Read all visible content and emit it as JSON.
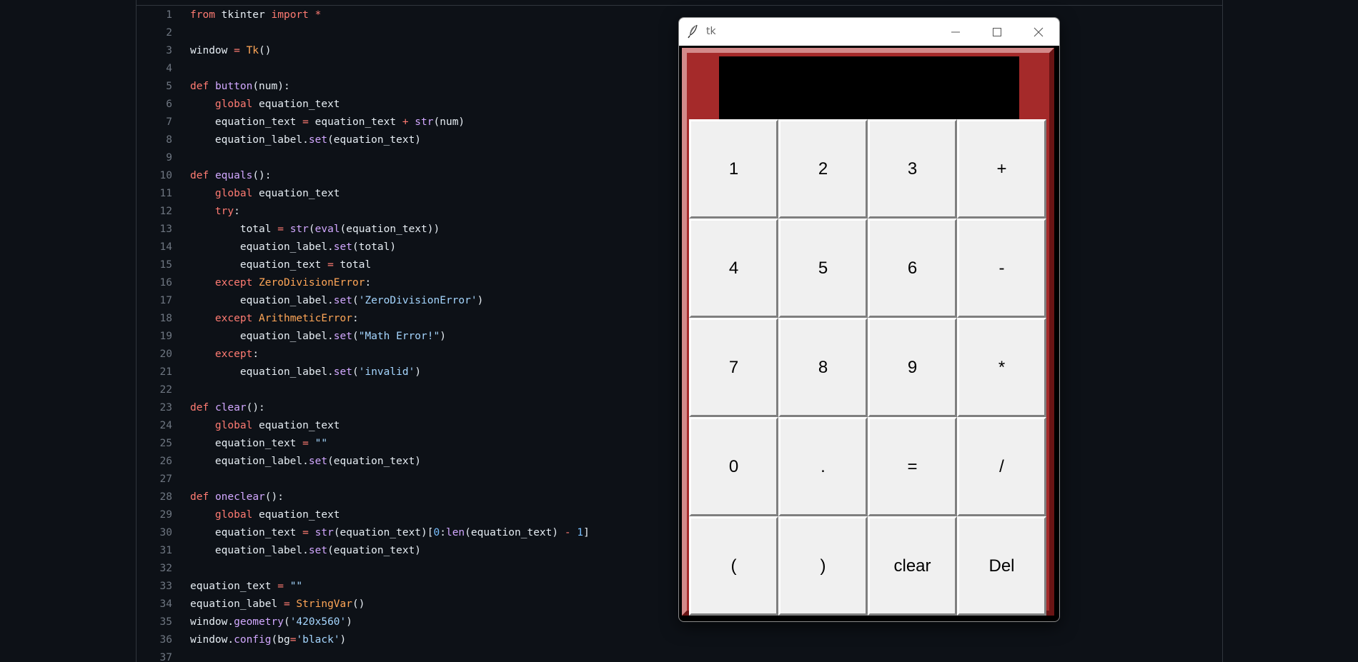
{
  "editor": {
    "lines": [
      {
        "n": "1",
        "tokens": [
          {
            "t": "from",
            "c": "kw"
          },
          {
            "t": " tkinter "
          },
          {
            "t": "import",
            "c": "kw"
          },
          {
            "t": " "
          },
          {
            "t": "*",
            "c": "op"
          }
        ]
      },
      {
        "n": "2",
        "tokens": []
      },
      {
        "n": "3",
        "tokens": [
          {
            "t": "window "
          },
          {
            "t": "=",
            "c": "op"
          },
          {
            "t": " "
          },
          {
            "t": "Tk",
            "c": "cls"
          },
          {
            "t": "()"
          }
        ]
      },
      {
        "n": "4",
        "tokens": []
      },
      {
        "n": "5",
        "tokens": [
          {
            "t": "def",
            "c": "kw"
          },
          {
            "t": " "
          },
          {
            "t": "button",
            "c": "fn"
          },
          {
            "t": "(num):"
          }
        ]
      },
      {
        "n": "6",
        "tokens": [
          {
            "t": "    "
          },
          {
            "t": "global",
            "c": "kw"
          },
          {
            "t": " equation_text"
          }
        ]
      },
      {
        "n": "7",
        "tokens": [
          {
            "t": "    equation_text "
          },
          {
            "t": "=",
            "c": "op"
          },
          {
            "t": " equation_text "
          },
          {
            "t": "+",
            "c": "op"
          },
          {
            "t": " "
          },
          {
            "t": "str",
            "c": "fn"
          },
          {
            "t": "(num)"
          }
        ]
      },
      {
        "n": "8",
        "tokens": [
          {
            "t": "    equation_label."
          },
          {
            "t": "set",
            "c": "fn"
          },
          {
            "t": "(equation_text)"
          }
        ]
      },
      {
        "n": "9",
        "tokens": []
      },
      {
        "n": "10",
        "tokens": [
          {
            "t": "def",
            "c": "kw"
          },
          {
            "t": " "
          },
          {
            "t": "equals",
            "c": "fn"
          },
          {
            "t": "():"
          }
        ]
      },
      {
        "n": "11",
        "tokens": [
          {
            "t": "    "
          },
          {
            "t": "global",
            "c": "kw"
          },
          {
            "t": " equation_text"
          }
        ]
      },
      {
        "n": "12",
        "tokens": [
          {
            "t": "    "
          },
          {
            "t": "try",
            "c": "kw"
          },
          {
            "t": ":"
          }
        ]
      },
      {
        "n": "13",
        "tokens": [
          {
            "t": "        total "
          },
          {
            "t": "=",
            "c": "op"
          },
          {
            "t": " "
          },
          {
            "t": "str",
            "c": "fn"
          },
          {
            "t": "("
          },
          {
            "t": "eval",
            "c": "fn"
          },
          {
            "t": "(equation_text))"
          }
        ]
      },
      {
        "n": "14",
        "tokens": [
          {
            "t": "        equation_label."
          },
          {
            "t": "set",
            "c": "fn"
          },
          {
            "t": "(total)"
          }
        ]
      },
      {
        "n": "15",
        "tokens": [
          {
            "t": "        equation_text "
          },
          {
            "t": "=",
            "c": "op"
          },
          {
            "t": " total"
          }
        ]
      },
      {
        "n": "16",
        "tokens": [
          {
            "t": "    "
          },
          {
            "t": "except",
            "c": "kw"
          },
          {
            "t": " "
          },
          {
            "t": "ZeroDivisionError",
            "c": "cls"
          },
          {
            "t": ":"
          }
        ]
      },
      {
        "n": "17",
        "tokens": [
          {
            "t": "        equation_label."
          },
          {
            "t": "set",
            "c": "fn"
          },
          {
            "t": "("
          },
          {
            "t": "'ZeroDivisionError'",
            "c": "str"
          },
          {
            "t": ")"
          }
        ]
      },
      {
        "n": "18",
        "tokens": [
          {
            "t": "    "
          },
          {
            "t": "except",
            "c": "kw"
          },
          {
            "t": " "
          },
          {
            "t": "ArithmeticError",
            "c": "cls"
          },
          {
            "t": ":"
          }
        ]
      },
      {
        "n": "19",
        "tokens": [
          {
            "t": "        equation_label."
          },
          {
            "t": "set",
            "c": "fn"
          },
          {
            "t": "("
          },
          {
            "t": "\"Math Error!\"",
            "c": "str"
          },
          {
            "t": ")"
          }
        ]
      },
      {
        "n": "20",
        "tokens": [
          {
            "t": "    "
          },
          {
            "t": "except",
            "c": "kw"
          },
          {
            "t": ":"
          }
        ]
      },
      {
        "n": "21",
        "tokens": [
          {
            "t": "        equation_label."
          },
          {
            "t": "set",
            "c": "fn"
          },
          {
            "t": "("
          },
          {
            "t": "'invalid'",
            "c": "str"
          },
          {
            "t": ")"
          }
        ]
      },
      {
        "n": "22",
        "tokens": []
      },
      {
        "n": "23",
        "tokens": [
          {
            "t": "def",
            "c": "kw"
          },
          {
            "t": " "
          },
          {
            "t": "clear",
            "c": "fn"
          },
          {
            "t": "():"
          }
        ]
      },
      {
        "n": "24",
        "tokens": [
          {
            "t": "    "
          },
          {
            "t": "global",
            "c": "kw"
          },
          {
            "t": " equation_text"
          }
        ]
      },
      {
        "n": "25",
        "tokens": [
          {
            "t": "    equation_text "
          },
          {
            "t": "=",
            "c": "op"
          },
          {
            "t": " "
          },
          {
            "t": "\"\"",
            "c": "str"
          }
        ]
      },
      {
        "n": "26",
        "tokens": [
          {
            "t": "    equation_label."
          },
          {
            "t": "set",
            "c": "fn"
          },
          {
            "t": "(equation_text)"
          }
        ]
      },
      {
        "n": "27",
        "tokens": []
      },
      {
        "n": "28",
        "tokens": [
          {
            "t": "def",
            "c": "kw"
          },
          {
            "t": " "
          },
          {
            "t": "oneclear",
            "c": "fn"
          },
          {
            "t": "():"
          }
        ]
      },
      {
        "n": "29",
        "tokens": [
          {
            "t": "    "
          },
          {
            "t": "global",
            "c": "kw"
          },
          {
            "t": " equation_text"
          }
        ]
      },
      {
        "n": "30",
        "tokens": [
          {
            "t": "    equation_text "
          },
          {
            "t": "=",
            "c": "op"
          },
          {
            "t": " "
          },
          {
            "t": "str",
            "c": "fn"
          },
          {
            "t": "(equation_text)["
          },
          {
            "t": "0",
            "c": "num"
          },
          {
            "t": ":"
          },
          {
            "t": "len",
            "c": "fn"
          },
          {
            "t": "(equation_text) "
          },
          {
            "t": "-",
            "c": "op"
          },
          {
            "t": " "
          },
          {
            "t": "1",
            "c": "num"
          },
          {
            "t": "]"
          }
        ]
      },
      {
        "n": "31",
        "tokens": [
          {
            "t": "    equation_label."
          },
          {
            "t": "set",
            "c": "fn"
          },
          {
            "t": "(equation_text)"
          }
        ]
      },
      {
        "n": "32",
        "tokens": []
      },
      {
        "n": "33",
        "tokens": [
          {
            "t": "equation_text "
          },
          {
            "t": "=",
            "c": "op"
          },
          {
            "t": " "
          },
          {
            "t": "\"\"",
            "c": "str"
          }
        ]
      },
      {
        "n": "34",
        "tokens": [
          {
            "t": "equation_label "
          },
          {
            "t": "=",
            "c": "op"
          },
          {
            "t": " "
          },
          {
            "t": "StringVar",
            "c": "cls"
          },
          {
            "t": "()"
          }
        ]
      },
      {
        "n": "35",
        "tokens": [
          {
            "t": "window."
          },
          {
            "t": "geometry",
            "c": "fn"
          },
          {
            "t": "("
          },
          {
            "t": "'420x560'",
            "c": "str"
          },
          {
            "t": ")"
          }
        ]
      },
      {
        "n": "36",
        "tokens": [
          {
            "t": "window."
          },
          {
            "t": "config",
            "c": "fn"
          },
          {
            "t": "(bg"
          },
          {
            "t": "=",
            "c": "op"
          },
          {
            "t": "'black'",
            "c": "str"
          },
          {
            "t": ")"
          }
        ]
      },
      {
        "n": "37",
        "tokens": []
      }
    ]
  },
  "tk_window": {
    "title": "tk",
    "icon": "feather-icon",
    "display_text": "",
    "colors": {
      "frame": "#a52a2a",
      "display": "#000000",
      "key": "#f0f0f0"
    },
    "keys": [
      [
        "1",
        "2",
        "3",
        "+"
      ],
      [
        "4",
        "5",
        "6",
        "-"
      ],
      [
        "7",
        "8",
        "9",
        "*"
      ],
      [
        "0",
        ".",
        "=",
        "/"
      ],
      [
        "(",
        ")",
        "clear",
        "Del"
      ]
    ]
  }
}
